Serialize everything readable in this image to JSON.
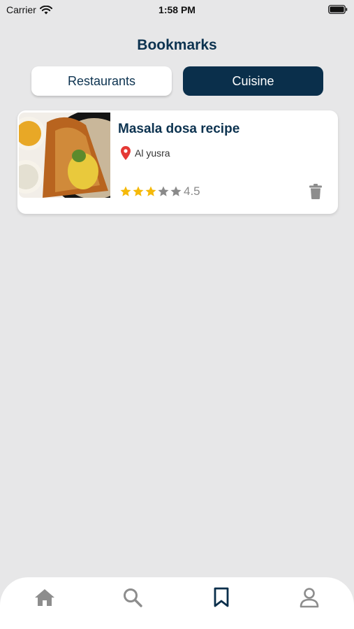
{
  "status_bar": {
    "carrier": "Carrier",
    "time": "1:58 PM"
  },
  "header": {
    "title": "Bookmarks"
  },
  "segments": {
    "restaurants": "Restaurants",
    "cuisine": "Cuisine",
    "active": "Cuisine"
  },
  "bookmarks": [
    {
      "title": "Masala dosa recipe",
      "location": "Al yusra",
      "rating": 4.5,
      "rating_label": "4.5",
      "stars_filled": 3,
      "stars_total": 5
    }
  ],
  "tab_bar": {
    "items": [
      {
        "icon": "home-icon"
      },
      {
        "icon": "search-icon"
      },
      {
        "icon": "bookmark-icon",
        "active": true
      },
      {
        "icon": "profile-icon"
      }
    ]
  },
  "colors": {
    "primary": "#0a2f4b",
    "star": "#f5b90a",
    "star_empty": "#8a8a8a",
    "pin": "#e53935",
    "background": "#e7e7e8"
  }
}
